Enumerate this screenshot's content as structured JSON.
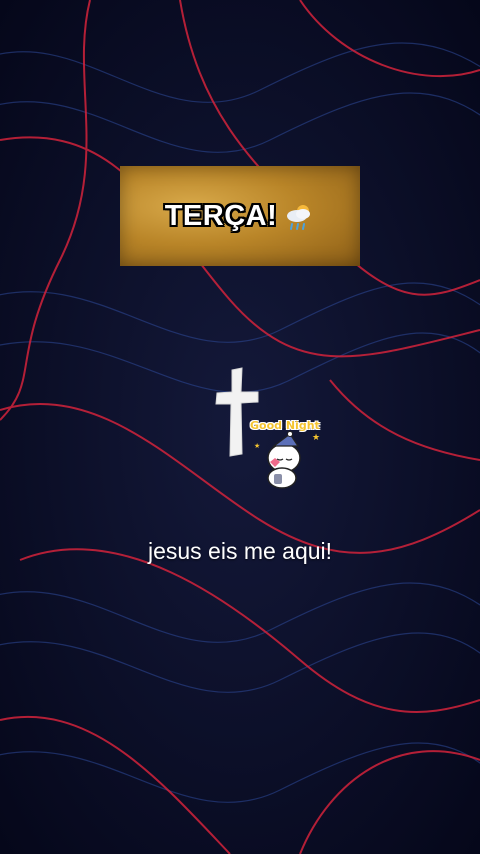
{
  "title_card": {
    "text": "TERÇA!",
    "icon": "sun-behind-rain-cloud-icon"
  },
  "decor": {
    "cross": "cross-icon",
    "sticker_text": "Good Night",
    "sticker_icon": "sleepy-bunny-icon"
  },
  "caption": "jesus eis me aqui!",
  "colors": {
    "background": "#0b0f22",
    "wave_red": "#d2233b",
    "wave_blue": "#2e4a9a",
    "card_gold": "#b98528"
  }
}
